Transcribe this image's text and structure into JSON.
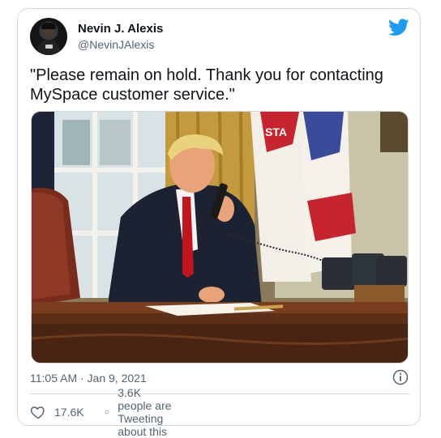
{
  "author": {
    "display_name": "Nevin J. Alexis",
    "handle": "@NevinJAlexis"
  },
  "icons": {
    "brand": "twitter-bird-icon",
    "info": "info-icon",
    "like": "heart-icon",
    "reply": "speech-bubble-icon"
  },
  "tweet": {
    "text": "\"Please remain on hold. Thank you for contacting MySpace customer service.\"",
    "timestamp": "11:05 AM · Jan 9, 2021"
  },
  "actions": {
    "likes": "17.6K",
    "tweeting": "3.6K people are Tweeting about this"
  },
  "colors": {
    "brand": "#1d9bf0",
    "secondary_text": "#536471",
    "border": "#cfd9de"
  }
}
